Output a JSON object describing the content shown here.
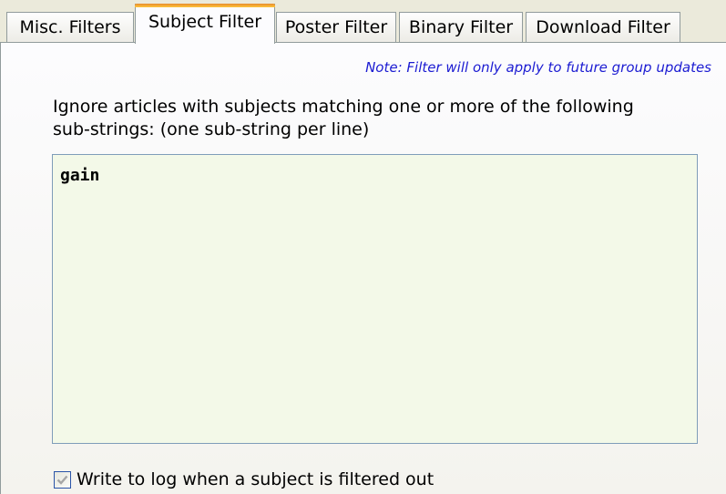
{
  "tabs": [
    {
      "label": "Misc. Filters",
      "active": false
    },
    {
      "label": "Subject Filter",
      "active": true
    },
    {
      "label": "Poster Filter",
      "active": false
    },
    {
      "label": "Binary Filter",
      "active": false
    },
    {
      "label": "Download Filter",
      "active": false
    }
  ],
  "subject_filter": {
    "note": "Note: Filter will only apply to future group updates",
    "description_line1": "Ignore articles with subjects matching one or more of the following",
    "description_line2": "sub-strings: (one sub-string per line)",
    "substrings_value": "gain",
    "log_checkbox": {
      "label": "Write to log when a subject is filtered out",
      "checked": true,
      "icon": "checkmark-icon"
    }
  },
  "colors": {
    "window_background": "#ebeadb",
    "panel_background": "#fcfcfe",
    "active_tab_accent": "#ffc73c",
    "note_text": "#1c1cd2",
    "textarea_background": "#f3f9e8",
    "checkbox_check": "#a6a6a6"
  }
}
